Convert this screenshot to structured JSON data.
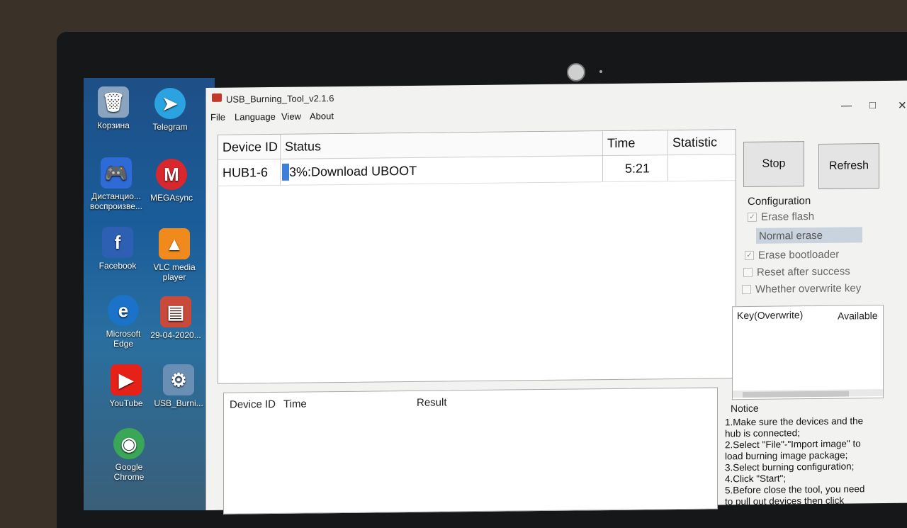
{
  "desktop": {
    "icons": [
      {
        "label": "Корзина",
        "icon": "recycle-bin-icon",
        "color": "#8aa4c0"
      },
      {
        "label": "Telegram",
        "icon": "telegram-icon",
        "color": "#2aa3e0"
      },
      {
        "label": "Дистанцио... воспроизве...",
        "icon": "ps-remote-play-icon",
        "color": "#2f6bd6"
      },
      {
        "label": "MEGAsync",
        "icon": "mega-icon",
        "color": "#d9272e"
      },
      {
        "label": "Facebook",
        "icon": "facebook-icon",
        "color": "#2d5fb3"
      },
      {
        "label": "VLC media player",
        "icon": "vlc-icon",
        "color": "#f08a1c"
      },
      {
        "label": "Microsoft Edge",
        "icon": "edge-icon",
        "color": "#1a73c8"
      },
      {
        "label": "29-04-2020...",
        "icon": "document-icon",
        "color": "#c94a3a"
      },
      {
        "label": "YouTube",
        "icon": "youtube-icon",
        "color": "#e62117"
      },
      {
        "label": "USB_Burni...",
        "icon": "usb-burning-icon",
        "color": "#6a8fb5"
      },
      {
        "label": "Google Chrome",
        "icon": "chrome-icon",
        "color": "#3aa757"
      }
    ]
  },
  "window": {
    "title": "USB_Burning_Tool_v2.1.6",
    "controls": {
      "minimize": "—",
      "maximize": "□",
      "close": "✕"
    }
  },
  "menu": [
    "File",
    "Language",
    "View",
    "About"
  ],
  "devices_table": {
    "headers": [
      "Device ID",
      "Status",
      "Time",
      "Statistic"
    ],
    "rows": [
      {
        "device_id": "HUB1-6",
        "status": "3%:Download UBOOT",
        "time": "5:21",
        "statistic": "",
        "progress": 0.03
      }
    ]
  },
  "results_table": {
    "headers": [
      "Device ID",
      "Time",
      "Result"
    ]
  },
  "buttons": {
    "stop": "Stop",
    "refresh": "Refresh"
  },
  "configuration": {
    "title": "Configuration",
    "erase_flash": {
      "label": "Erase flash",
      "checked": true
    },
    "erase_mode": "Normal erase",
    "erase_bootloader": {
      "label": "Erase bootloader",
      "checked": true
    },
    "reset_after_success": {
      "label": "Reset after success",
      "checked": false
    },
    "overwrite_key": {
      "label": "Whether overwrite key",
      "checked": false
    }
  },
  "key_panel": {
    "col1": "Key(Overwrite)",
    "col2": "Available"
  },
  "notice": {
    "title": "Notice",
    "lines": [
      "1.Make sure the devices and the",
      "hub is connected;",
      "2.Select \"File\"-\"Import image\" to",
      "load burning image package;",
      "3.Select burning configuration;",
      "4.Click \"Start\";",
      "5.Before close the tool, you need",
      "to pull out devices then click"
    ]
  }
}
